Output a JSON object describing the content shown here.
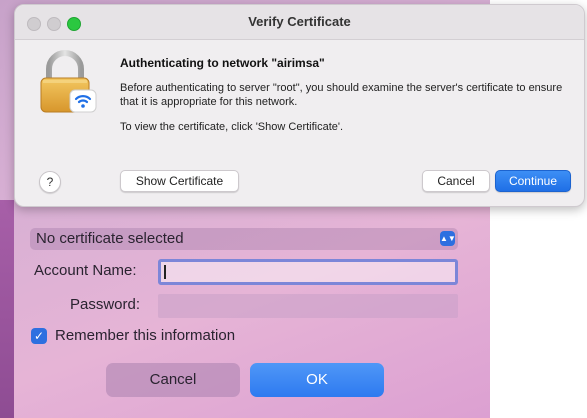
{
  "window": {
    "title": "Verify Certificate"
  },
  "dialog": {
    "heading": "Authenticating to network \"airimsa\"",
    "body": "Before authenticating to server \"root\", you should examine the server's certificate to ensure that it is appropriate for this network.",
    "hint": "To view the certificate, click 'Show Certificate'.",
    "icon": "lock-wifi-icon",
    "buttons": {
      "help": "?",
      "show_certificate": "Show Certificate",
      "cancel": "Cancel",
      "continue": "Continue"
    }
  },
  "login": {
    "certificate_select": "No certificate selected",
    "account_label": "Account Name:",
    "account_value": "",
    "password_label": "Password:",
    "remember_label": "Remember this information",
    "remember_checked": true,
    "cancel_label": "Cancel",
    "ok_label": "OK"
  },
  "colors": {
    "accent": "#2e7af0",
    "lock_gold": "#e0a73c"
  }
}
